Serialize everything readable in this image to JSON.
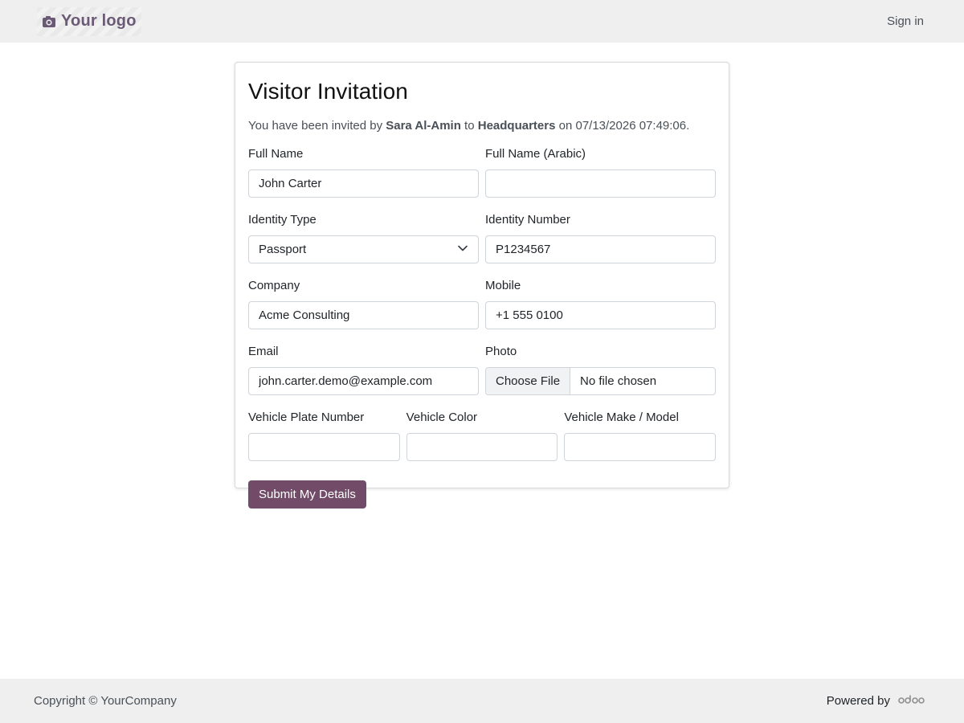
{
  "header": {
    "logo_text": "Your logo",
    "signin_label": "Sign in"
  },
  "card": {
    "title": "Visitor Invitation",
    "intro": {
      "prefix": "You have been invited by ",
      "inviter": "Sara Al-Amin",
      "mid": " to ",
      "location": "Headquarters",
      "suffix": " on 07/13/2026 07:49:06."
    },
    "fields": {
      "full_name": {
        "label": "Full Name",
        "value": "John Carter"
      },
      "full_name_arabic": {
        "label": "Full Name (Arabic)",
        "value": ""
      },
      "identity_type": {
        "label": "Identity Type",
        "value": "Passport"
      },
      "identity_number": {
        "label": "Identity Number",
        "value": "P1234567"
      },
      "company": {
        "label": "Company",
        "value": "Acme Consulting"
      },
      "mobile": {
        "label": "Mobile",
        "value": "+1 555 0100"
      },
      "email": {
        "label": "Email",
        "value": "john.carter.demo@example.com"
      },
      "photo": {
        "label": "Photo",
        "button": "Choose File",
        "status": "No file chosen"
      },
      "vehicle_plate": {
        "label": "Vehicle Plate Number",
        "value": ""
      },
      "vehicle_color": {
        "label": "Vehicle Color",
        "value": ""
      },
      "vehicle_make": {
        "label": "Vehicle Make / Model",
        "value": ""
      }
    },
    "submit_label": "Submit My Details"
  },
  "footer": {
    "copyright": "Copyright © YourCompany",
    "powered_by": "Powered by",
    "brand": "odoo"
  },
  "colors": {
    "accent": "#714b67",
    "logo": "#6a5a76",
    "bar_bg": "#efefef"
  },
  "icons": {
    "logo": "camera-icon",
    "select": "chevron-down-icon"
  }
}
